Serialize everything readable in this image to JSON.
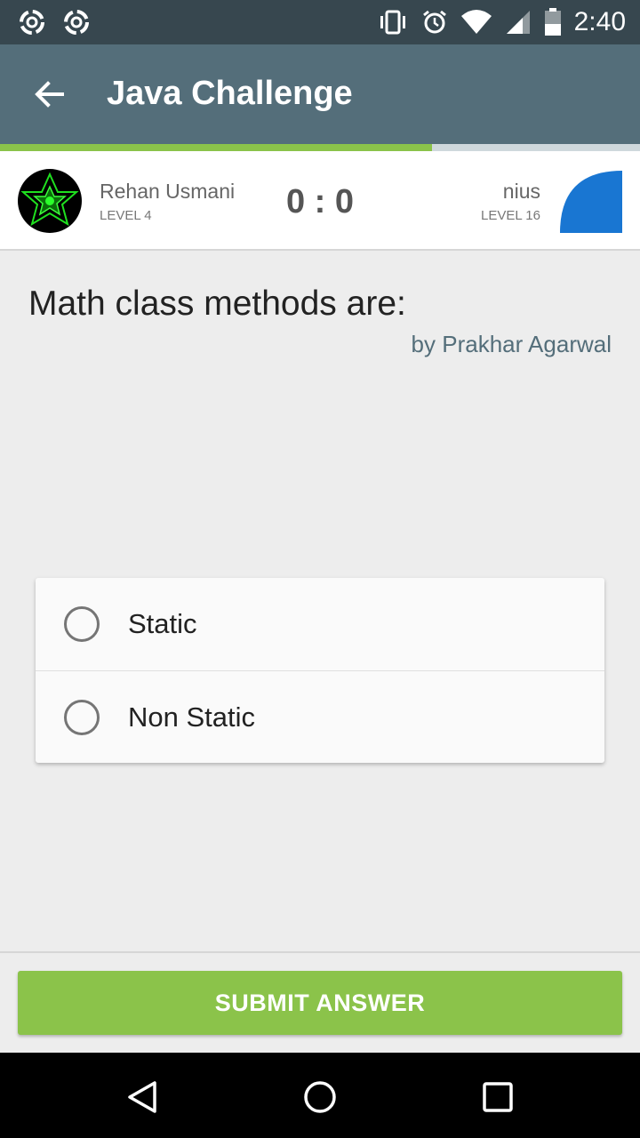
{
  "status_bar": {
    "time": "2:40",
    "left_icons": [
      "notification-swirl-icon",
      "notification-swirl-icon"
    ],
    "right_icons": [
      "vibrate-icon",
      "alarm-icon",
      "wifi-icon",
      "cellular-signal-icon",
      "battery-icon"
    ]
  },
  "app_bar": {
    "title": "Java Challenge",
    "back_icon": "arrow-left-icon"
  },
  "progress": {
    "fraction": 0.675,
    "fill_color": "#8bc34a"
  },
  "players": {
    "left": {
      "name": "Rehan Usmani",
      "level": "LEVEL 4"
    },
    "score": "0 : 0",
    "right": {
      "name": "nius",
      "level": "LEVEL 16"
    }
  },
  "question": {
    "text": "Math class methods are:",
    "author": "by Prakhar Agarwal"
  },
  "options": [
    {
      "label": "Static",
      "selected": false
    },
    {
      "label": "Non Static",
      "selected": false
    }
  ],
  "submit": {
    "label": "SUBMIT ANSWER",
    "color": "#8bc34a"
  },
  "nav_bar": {
    "icons": [
      "back-triangle-icon",
      "home-circle-icon",
      "recents-square-icon"
    ]
  },
  "colors": {
    "status_bar": "#37474f",
    "app_bar": "#546e7a",
    "accent": "#8bc34a",
    "opponent_avatar": "#1976d2"
  }
}
